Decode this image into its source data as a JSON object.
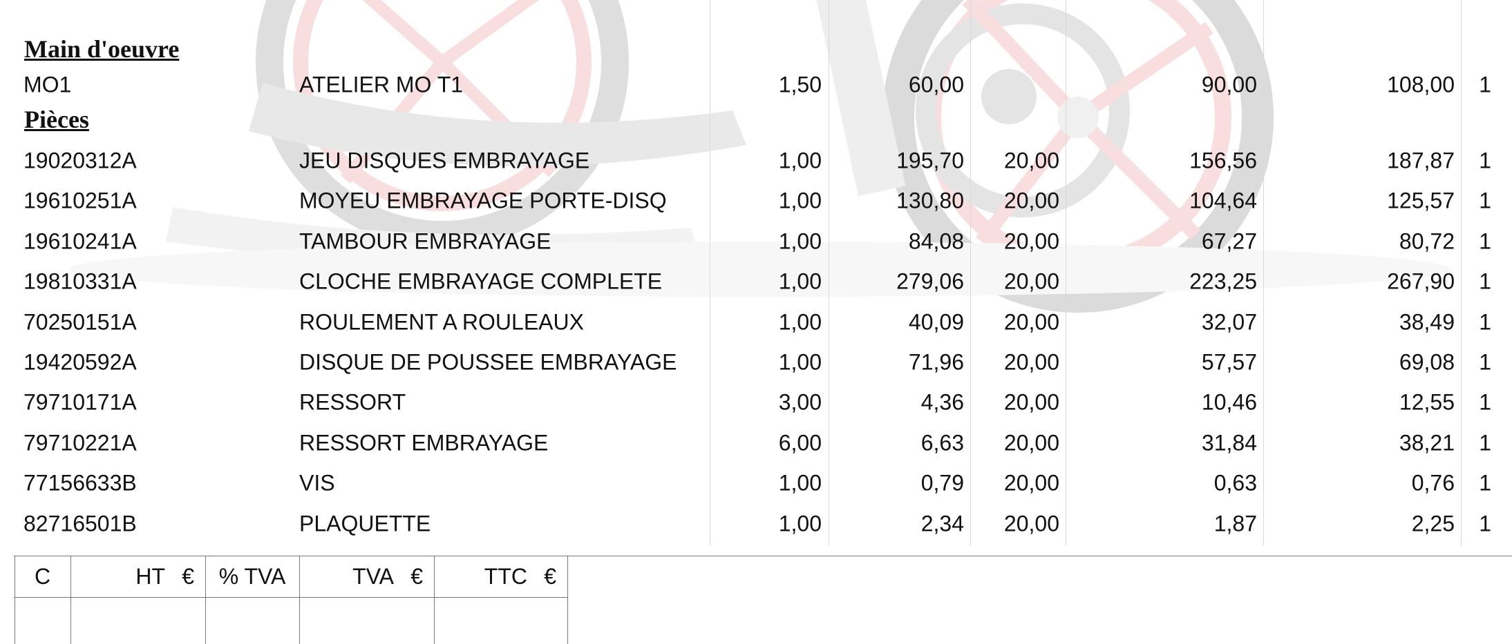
{
  "sections": {
    "labour": "Main d'oeuvre",
    "parts": "Pièces"
  },
  "labour_rows": [
    {
      "code": "MO1",
      "description": "ATELIER MO T1",
      "qty": "1,50",
      "unit_price": "60,00",
      "tva": "",
      "total_ht": "90,00",
      "total_ttc": "108,00",
      "last": "1"
    }
  ],
  "part_rows": [
    {
      "code": "19020312A",
      "description": "JEU DISQUES EMBRAYAGE",
      "qty": "1,00",
      "unit_price": "195,70",
      "tva": "20,00",
      "total_ht": "156,56",
      "total_ttc": "187,87",
      "last": "1"
    },
    {
      "code": "19610251A",
      "description": "MOYEU EMBRAYAGE PORTE-DISQ",
      "qty": "1,00",
      "unit_price": "130,80",
      "tva": "20,00",
      "total_ht": "104,64",
      "total_ttc": "125,57",
      "last": "1"
    },
    {
      "code": "19610241A",
      "description": "TAMBOUR EMBRAYAGE",
      "qty": "1,00",
      "unit_price": "84,08",
      "tva": "20,00",
      "total_ht": "67,27",
      "total_ttc": "80,72",
      "last": "1"
    },
    {
      "code": "19810331A",
      "description": "CLOCHE EMBRAYAGE COMPLETE",
      "qty": "1,00",
      "unit_price": "279,06",
      "tva": "20,00",
      "total_ht": "223,25",
      "total_ttc": "267,90",
      "last": "1"
    },
    {
      "code": "70250151A",
      "description": "ROULEMENT A ROULEAUX",
      "qty": "1,00",
      "unit_price": "40,09",
      "tva": "20,00",
      "total_ht": "32,07",
      "total_ttc": "38,49",
      "last": "1"
    },
    {
      "code": "19420592A",
      "description": "DISQUE DE POUSSEE EMBRAYAGE",
      "qty": "1,00",
      "unit_price": "71,96",
      "tva": "20,00",
      "total_ht": "57,57",
      "total_ttc": "69,08",
      "last": "1"
    },
    {
      "code": "79710171A",
      "description": "RESSORT",
      "qty": "3,00",
      "unit_price": "4,36",
      "tva": "20,00",
      "total_ht": "10,46",
      "total_ttc": "12,55",
      "last": "1"
    },
    {
      "code": "79710221A",
      "description": "RESSORT EMBRAYAGE",
      "qty": "6,00",
      "unit_price": "6,63",
      "tva": "20,00",
      "total_ht": "31,84",
      "total_ttc": "38,21",
      "last": "1"
    },
    {
      "code": "77156633B",
      "description": "VIS",
      "qty": "1,00",
      "unit_price": "0,79",
      "tva": "20,00",
      "total_ht": "0,63",
      "total_ttc": "0,76",
      "last": "1"
    },
    {
      "code": "82716501B",
      "description": "PLAQUETTE",
      "qty": "1,00",
      "unit_price": "2,34",
      "tva": "20,00",
      "total_ht": "1,87",
      "total_ttc": "2,25",
      "last": "1"
    }
  ],
  "totals_header": {
    "c": "C",
    "ht": "HT",
    "ht_cur": "€",
    "pct_tva": "% TVA",
    "tva": "TVA",
    "tva_cur": "€",
    "ttc": "TTC",
    "ttc_cur": "€"
  },
  "colors": {
    "watermark_red": "#e06f73",
    "watermark_grey": "#d7d7d7"
  }
}
